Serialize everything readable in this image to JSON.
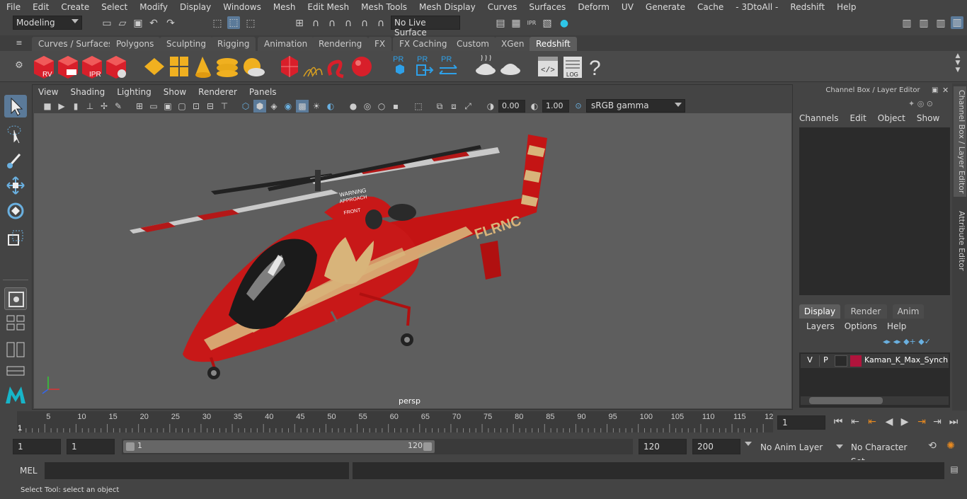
{
  "menubar": {
    "items": [
      "File",
      "Edit",
      "Create",
      "Select",
      "Modify",
      "Display",
      "Windows",
      "Mesh",
      "Edit Mesh",
      "Mesh Tools",
      "Mesh Display",
      "Curves",
      "Surfaces",
      "Deform",
      "UV",
      "Generate",
      "Cache",
      "- 3DtoAll -",
      "Redshift",
      "Help"
    ]
  },
  "statusline": {
    "mode": "Modeling",
    "live_surface": "No Live Surface"
  },
  "shelf": {
    "tabs": [
      "Curves / Surfaces",
      "Polygons",
      "Sculpting",
      "Rigging",
      "Animation",
      "Rendering",
      "FX",
      "FX Caching",
      "Custom",
      "XGen",
      "Redshift"
    ],
    "active_tab": "Redshift",
    "labels": {
      "rv": "RV",
      "ipr": "IPR",
      "pr": "PR",
      "log": "LOG",
      "help": "?"
    }
  },
  "viewport": {
    "menu": [
      "View",
      "Shading",
      "Lighting",
      "Show",
      "Renderer",
      "Panels"
    ],
    "exposure": "0.00",
    "gamma": "1.00",
    "colorspace": "sRGB gamma",
    "camera_label": "persp",
    "model_text": {
      "reg": "FLRNC",
      "warning": "WARNING",
      "approach": "APPROACH",
      "front": "FRONT"
    }
  },
  "channelbox": {
    "title": "Channel Box / Layer Editor",
    "menu": [
      "Channels",
      "Edit",
      "Object",
      "Show"
    ],
    "layer_tabs": [
      "Display",
      "Render",
      "Anim"
    ],
    "active_layer_tab": "Display",
    "layer_menu": [
      "Layers",
      "Options",
      "Help"
    ],
    "layer": {
      "v": "V",
      "p": "P",
      "name": "Kaman_K_Max_Synchro",
      "color": "#b0143c"
    }
  },
  "side_tabs": [
    "Channel Box / Layer Editor",
    "Attribute Editor"
  ],
  "timeline": {
    "ticks": [
      5,
      10,
      15,
      20,
      25,
      30,
      35,
      40,
      45,
      50,
      55,
      60,
      65,
      70,
      75,
      80,
      85,
      90,
      95,
      100,
      105,
      110,
      115,
      12
    ],
    "start_marker": "1",
    "current_frame": "1"
  },
  "range": {
    "start": "1",
    "anim_start": "1",
    "slider_start": "1",
    "slider_end": "120",
    "end": "120",
    "anim_end": "200",
    "anim_layer": "No Anim Layer",
    "character_set": "No Character Set"
  },
  "cmdline": {
    "label": "MEL"
  },
  "helpline": {
    "text": "Select Tool: select an object"
  }
}
